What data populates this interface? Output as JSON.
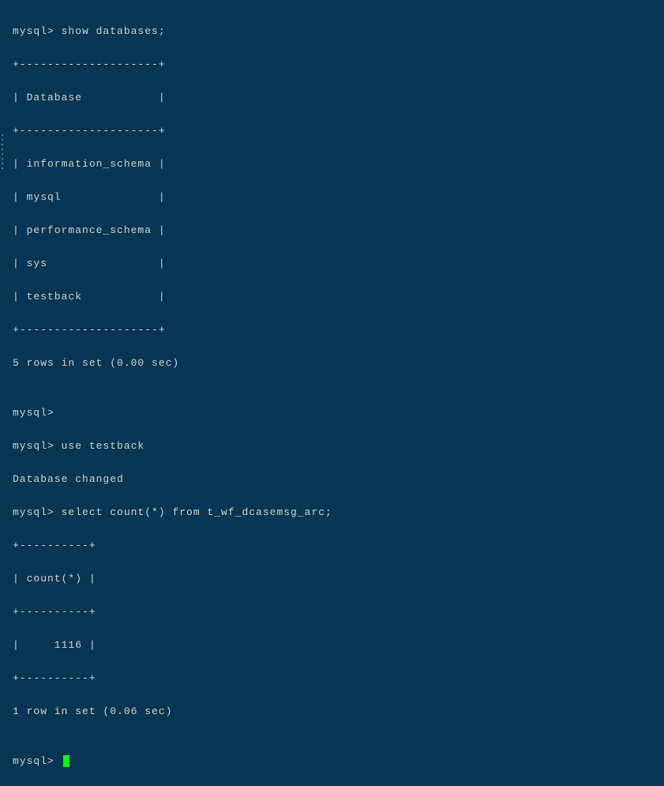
{
  "terminal": {
    "lines": [
      "mysql> show databases;",
      "+--------------------+",
      "| Database           |",
      "+--------------------+",
      "| information_schema |",
      "| mysql              |",
      "| performance_schema |",
      "| sys                |",
      "| testback           |",
      "+--------------------+",
      "5 rows in set (0.00 sec)",
      "",
      "mysql>",
      "mysql> use testback",
      "Database changed",
      "mysql> select count(*) from t_wf_dcasemsg_arc;",
      "+----------+",
      "| count(*) |",
      "+----------+",
      "|     1116 |",
      "+----------+",
      "1 row in set (0.06 sec)",
      "",
      "mysql> "
    ],
    "prompt": "mysql>"
  }
}
